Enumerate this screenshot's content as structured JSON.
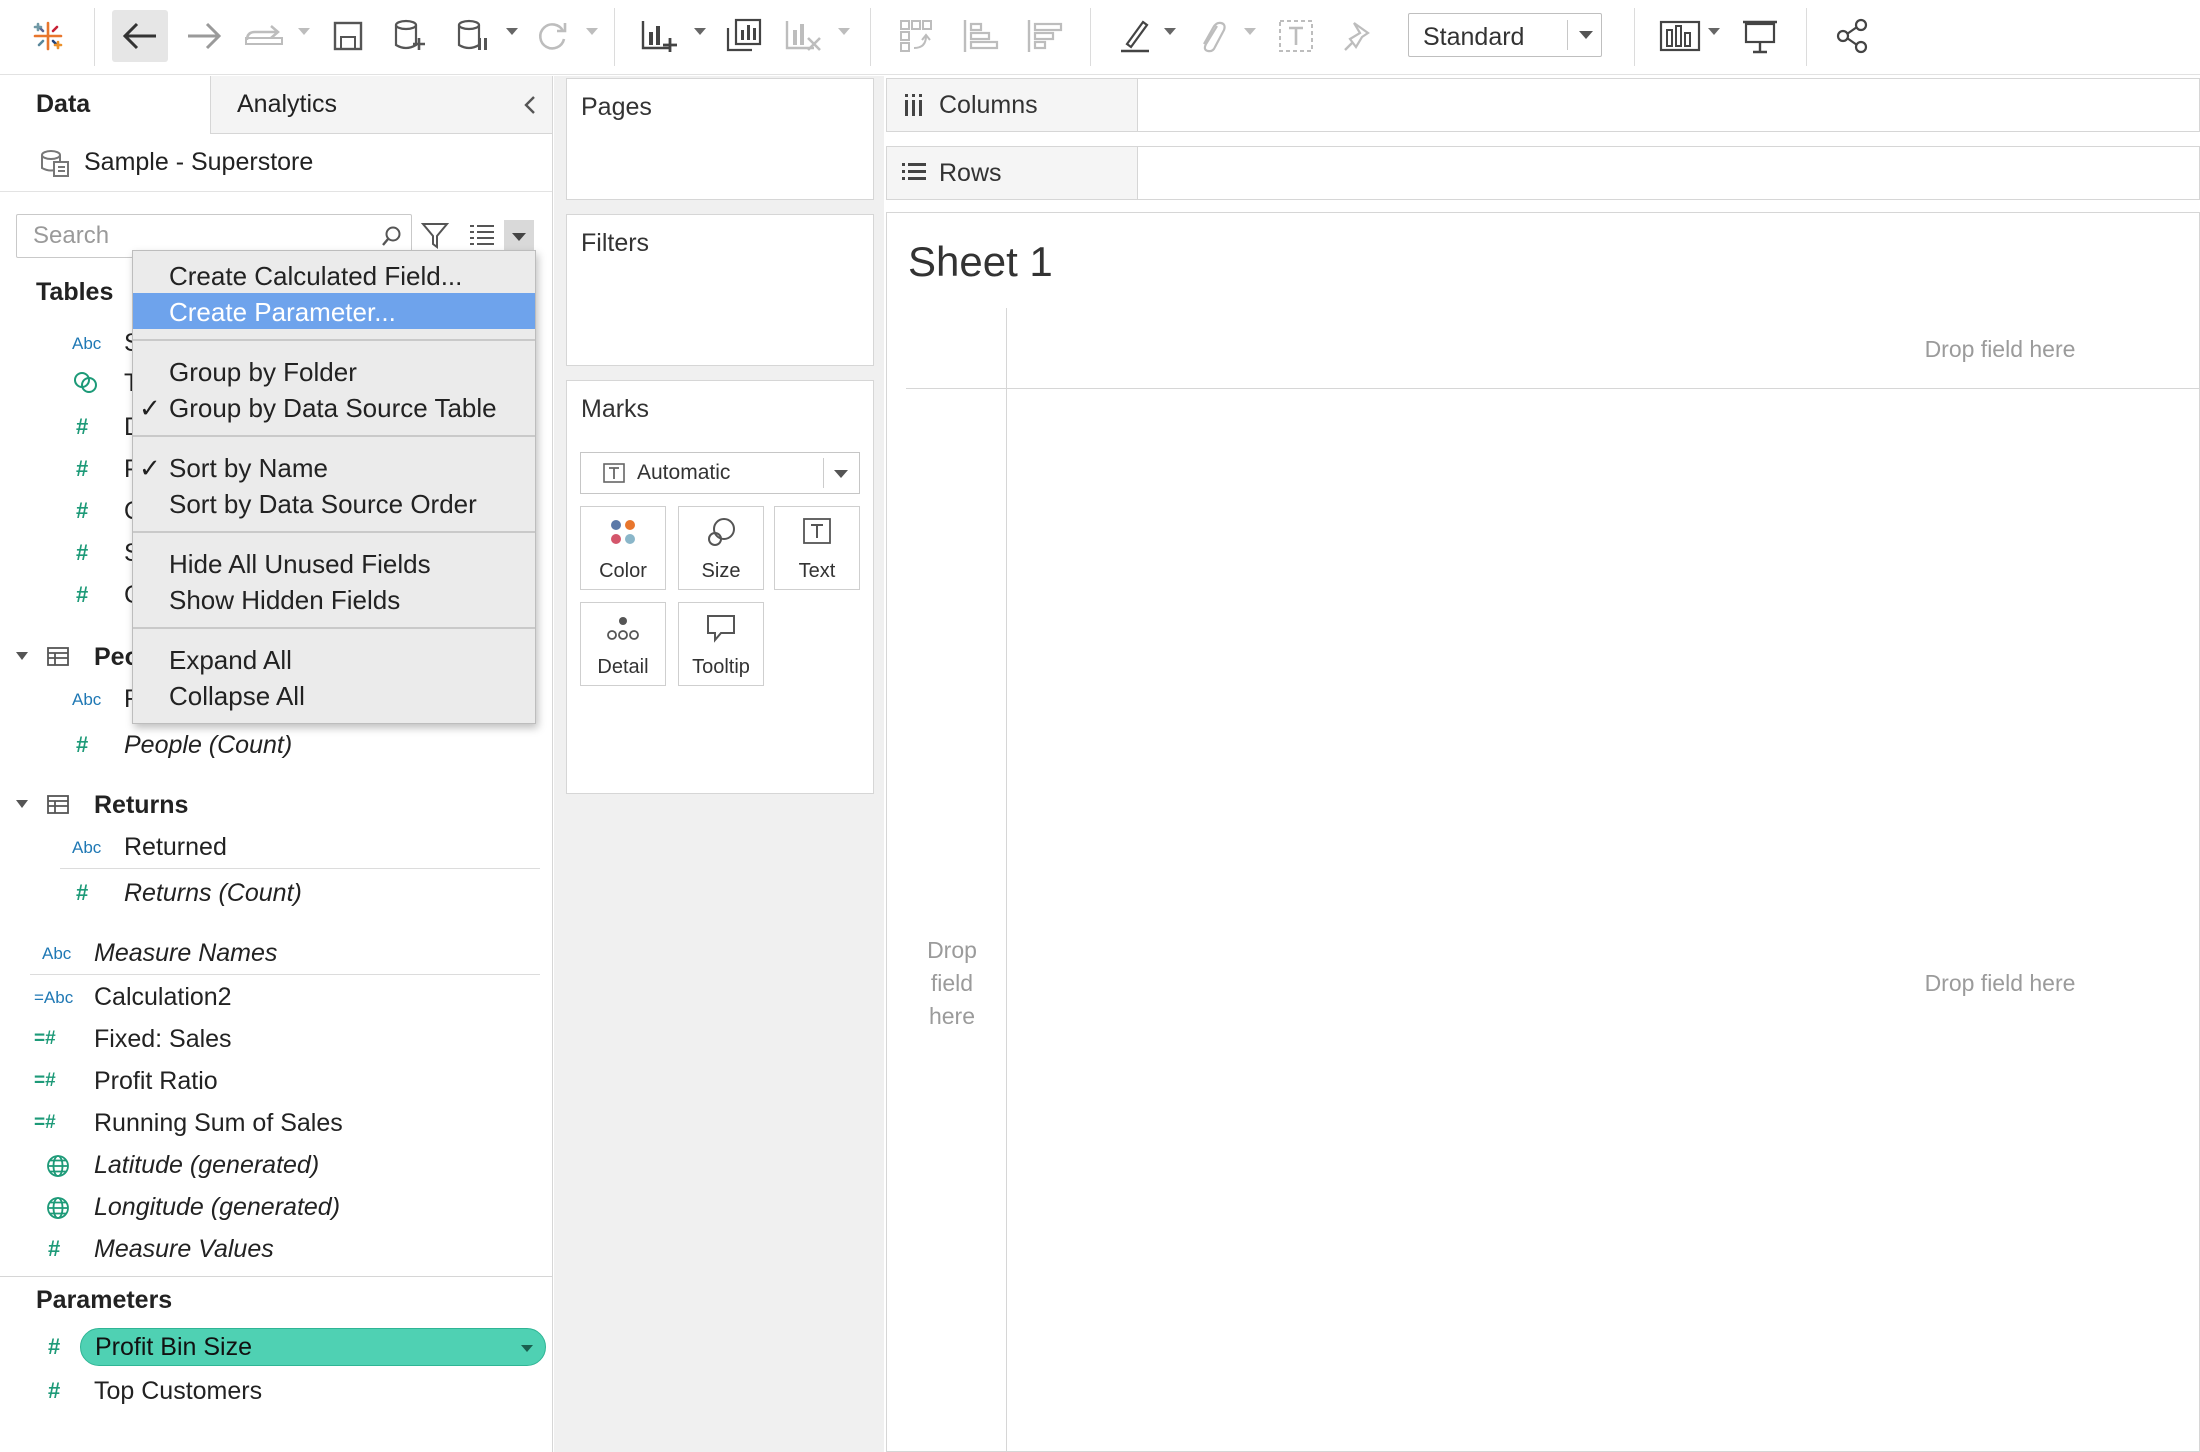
{
  "toolbar": {
    "view_mode": "Standard",
    "icons": [
      "tableau-logo-icon",
      "undo-icon",
      "redo-icon",
      "replay-icon",
      "save-icon",
      "new-datasource-icon",
      "pause-updates-icon",
      "refresh-icon",
      "new-worksheet-icon",
      "duplicate-sheet-icon",
      "clear-sheet-icon",
      "swap-icon",
      "sort-ascending-icon",
      "sort-descending-icon",
      "highlight-icon",
      "group-icon",
      "labels-icon",
      "fix-axes-icon",
      "show-me-icon",
      "presentation-icon",
      "share-icon"
    ]
  },
  "left_pane": {
    "tabs": {
      "data": "Data",
      "analytics": "Analytics"
    },
    "datasource": "Sample - Superstore",
    "search_placeholder": "Search",
    "tables_header": "Tables",
    "people_table_partial": "Peo",
    "people_count": "People (Count)",
    "returns_table": "Returns",
    "returns_fields": [
      "Returned",
      "Returns (Count)"
    ],
    "measure_names": "Measure Names",
    "measures": [
      "Calculation2",
      "Fixed: Sales",
      "Profit Ratio",
      "Running Sum of Sales",
      "Latitude (generated)",
      "Longitude (generated)",
      "Measure Values"
    ],
    "parameters_header": "Parameters",
    "parameters": [
      "Profit Bin Size",
      "Top Customers"
    ],
    "partial_first_letters": [
      "S",
      "T",
      "D",
      "P",
      "Q",
      "S",
      "C",
      "R"
    ]
  },
  "context_menu": {
    "items": [
      {
        "label": "Create Calculated Field...",
        "checked": false
      },
      {
        "label": "Create Parameter...",
        "checked": false,
        "highlighted": true
      },
      {
        "label": "Group by Folder",
        "checked": false
      },
      {
        "label": "Group by Data Source Table",
        "checked": true
      },
      {
        "label": "Sort by Name",
        "checked": true
      },
      {
        "label": "Sort by Data Source Order",
        "checked": false
      },
      {
        "label": "Hide All Unused Fields",
        "checked": false
      },
      {
        "label": "Show Hidden Fields",
        "checked": false
      },
      {
        "label": "Expand All",
        "checked": false
      },
      {
        "label": "Collapse All",
        "checked": false
      }
    ],
    "check_glyph": "✓"
  },
  "shelves": {
    "pages": "Pages",
    "filters": "Filters",
    "marks": "Marks",
    "mark_type": "Automatic",
    "mark_buttons": [
      "Color",
      "Size",
      "Text",
      "Detail",
      "Tooltip"
    ],
    "columns": "Columns",
    "rows": "Rows"
  },
  "sheet": {
    "title": "Sheet 1",
    "drop_top": "Drop field here",
    "drop_main": "Drop field here",
    "drop_left": "Drop field here"
  },
  "colors": {
    "highlight": "#6ea3ec",
    "measure_green": "#1d9a78",
    "dimension_blue": "#1f78b4",
    "parameter_pill": "#4fd1b3"
  }
}
